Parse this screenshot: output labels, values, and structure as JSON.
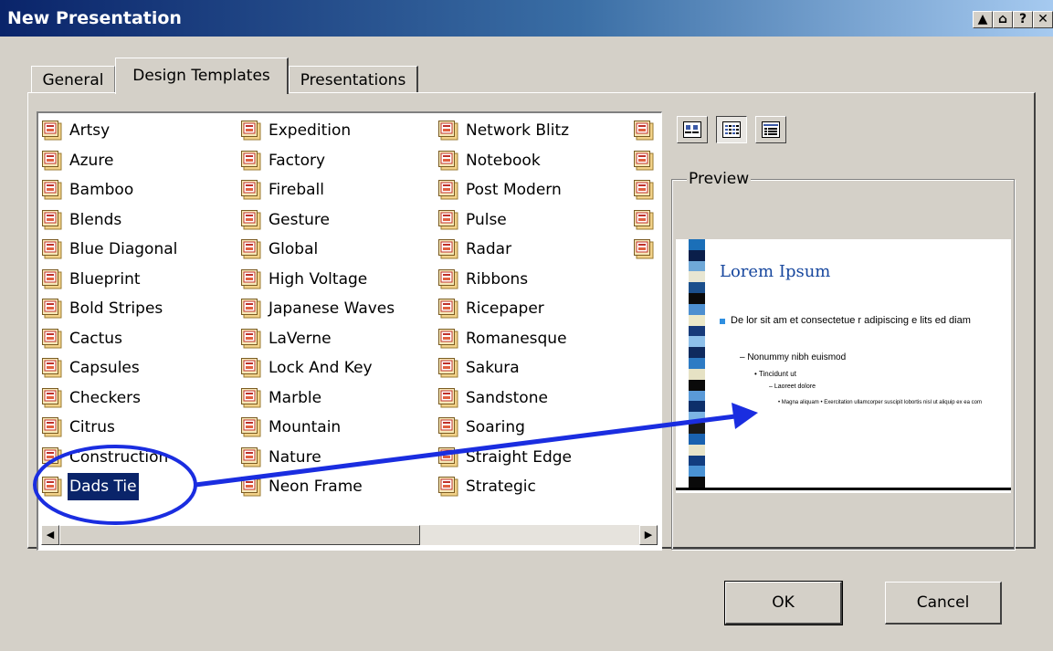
{
  "window": {
    "title": "New Presentation",
    "buttons": [
      "▲",
      "⌂",
      "?",
      "✕"
    ]
  },
  "tabs": [
    {
      "label": "General",
      "active": false
    },
    {
      "label": "Design Templates",
      "active": true
    },
    {
      "label": "Presentations",
      "active": false
    }
  ],
  "templates": {
    "columns": [
      [
        "Artsy",
        "Azure",
        "Bamboo",
        "Blends",
        "Blue Diagonal",
        "Blueprint",
        "Bold Stripes",
        "Cactus",
        "Capsules",
        "Checkers",
        "Citrus",
        "Construction",
        "Dads Tie"
      ],
      [
        "Expedition",
        "Factory",
        "Fireball",
        "Gesture",
        "Global",
        "High Voltage",
        "Japanese Waves",
        "LaVerne",
        "Lock And Key",
        "Marble",
        "Mountain",
        "Nature",
        "Neon Frame"
      ],
      [
        "Network Blitz",
        "Notebook",
        "Post Modern",
        "Pulse",
        "Radar",
        "Ribbons",
        "Ricepaper",
        "Romanesque",
        "Sakura",
        "Sandstone",
        "Soaring",
        "Straight Edge",
        "Strategic"
      ]
    ],
    "partial_column_count": 5,
    "selected": "Dads Tie"
  },
  "view_buttons": [
    "large-icons-view",
    "list-view",
    "details-view"
  ],
  "preview": {
    "group_label": "Preview",
    "slide_title": "Lorem Ipsum",
    "bullet1": "De lor sit am et consectetue r adipiscing e lits ed diam",
    "bullet2": "– Nonummy nibh euismod",
    "bullet3": "• Tincidunt ut",
    "bullet4": "– Laoreet dolore",
    "bullet5": "• Magna aliquam • Exercitation ullamcorper suscipit lobortis nisl ut aliquip ex ea com"
  },
  "footer": {
    "ok_label": "OK",
    "cancel_label": "Cancel"
  },
  "colors": {
    "selection": "#0a246a",
    "annotation": "#1a2de0",
    "title_blue": "#17479e"
  }
}
